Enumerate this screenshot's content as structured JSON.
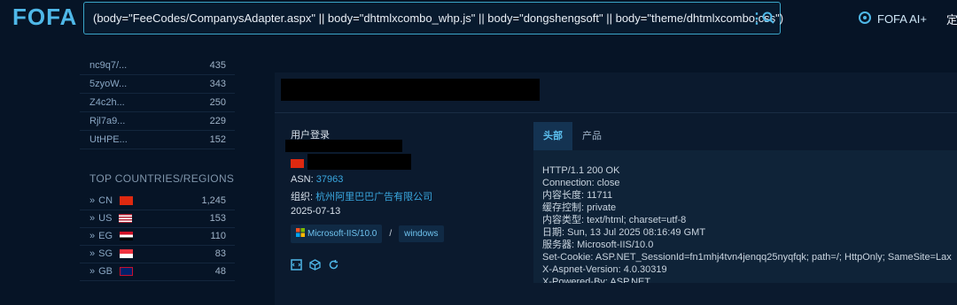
{
  "app": {
    "logo": "FOFA"
  },
  "search": {
    "query": "(body=\"FeeCodes/CompanysAdapter.aspx\" || body=\"dhtmlxcombo_whp.js\" || body=\"dongshengsoft\" || body=\"theme/dhtmlxcombo.css\")"
  },
  "header": {
    "ai_label": "FOFA AI+",
    "cut_label": "定"
  },
  "stats": {
    "items": [
      {
        "name": "nc9q7/...",
        "count": "435"
      },
      {
        "name": "5zyoW...",
        "count": "343"
      },
      {
        "name": "Z4c2h...",
        "count": "250"
      },
      {
        "name": "Rjl7a9...",
        "count": "229"
      },
      {
        "name": "UtHPE...",
        "count": "152"
      }
    ],
    "countries_title": "TOP COUNTRIES/REGIONS",
    "countries": [
      {
        "code": "CN",
        "count": "1,245",
        "flag": "cn"
      },
      {
        "code": "US",
        "count": "153",
        "flag": "us"
      },
      {
        "code": "EG",
        "count": "110",
        "flag": "eg"
      },
      {
        "code": "SG",
        "count": "83",
        "flag": "sg"
      },
      {
        "code": "GB",
        "count": "48",
        "flag": "gb"
      }
    ]
  },
  "result": {
    "page_title": "用户登录",
    "asn_label": "ASN:",
    "asn": "37963",
    "org_label": "组织:",
    "org": "杭州阿里巴巴广告有限公司",
    "date": "2025-07-13",
    "server_tag": "Microsoft-IIS/10.0",
    "separator": "/",
    "os_tag": "windows",
    "tabs": [
      "头部",
      "产品"
    ],
    "headers": [
      "HTTP/1.1 200 OK",
      "Connection: close",
      "内容长度: 11711",
      "缓存控制: private",
      "内容类型: text/html; charset=utf-8",
      "日期: Sun, 13 Jul 2025 08:16:49 GMT",
      "服务器: Microsoft-IIS/10.0",
      "Set-Cookie: ASP.NET_SessionId=fn1mhj4tvn4jenqq25nyqfqk; path=/; HttpOnly; SameSite=Lax",
      "X-Aspnet-Version: 4.0.30319",
      "X-Powered-By: ASP.NET"
    ]
  },
  "colors": {
    "accent": "#4fb8e8",
    "background": "#061426",
    "panel": "#0b1a2e"
  }
}
